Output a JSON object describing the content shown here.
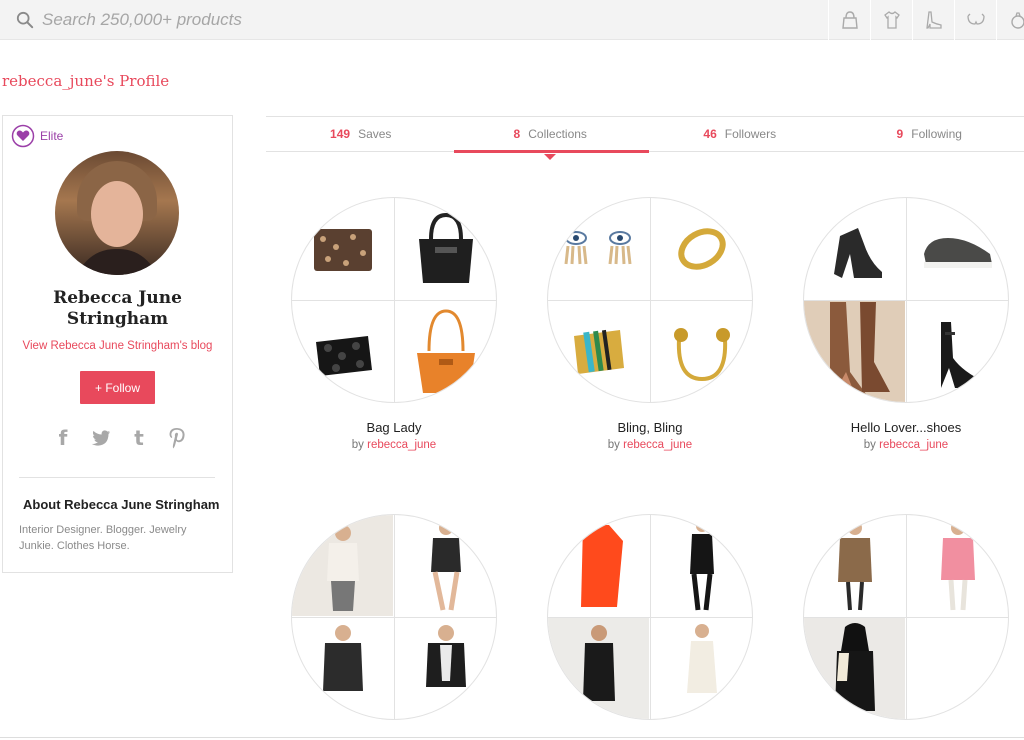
{
  "search": {
    "placeholder": "Search 250,000+ products"
  },
  "category_icons": [
    "bag-icon",
    "shirt-icon",
    "shoe-icon",
    "bra-icon",
    "ring-icon"
  ],
  "profile_title": "rebecca_june's Profile",
  "sidebar": {
    "badge": "Elite",
    "name": "Rebecca June Stringham",
    "blog_link": "View Rebecca June Stringham's blog",
    "follow_label": "+ Follow",
    "socials": [
      "facebook-icon",
      "twitter-icon",
      "tumblr-icon",
      "pinterest-icon"
    ],
    "about_title": "About Rebecca June Stringham",
    "about_text": "Interior Designer. Blogger. Jewelry Junkie. Clothes Horse."
  },
  "stats": [
    {
      "count": "149",
      "label": "Saves"
    },
    {
      "count": "8",
      "label": "Collections",
      "active": true
    },
    {
      "count": "46",
      "label": "Followers"
    },
    {
      "count": "9",
      "label": "Following"
    }
  ],
  "collections": [
    {
      "title": "Bag Lady",
      "by_prefix": "by",
      "author": "rebecca_june"
    },
    {
      "title": "Bling, Bling",
      "by_prefix": "by",
      "author": "rebecca_june"
    },
    {
      "title": "Hello Lover...shoes",
      "by_prefix": "by",
      "author": "rebecca_june"
    },
    {
      "title": "",
      "by_prefix": "",
      "author": ""
    },
    {
      "title": "",
      "by_prefix": "",
      "author": ""
    },
    {
      "title": "",
      "by_prefix": "",
      "author": ""
    }
  ],
  "colors": {
    "accent": "#e8495c",
    "elite": "#9b3fa8"
  }
}
